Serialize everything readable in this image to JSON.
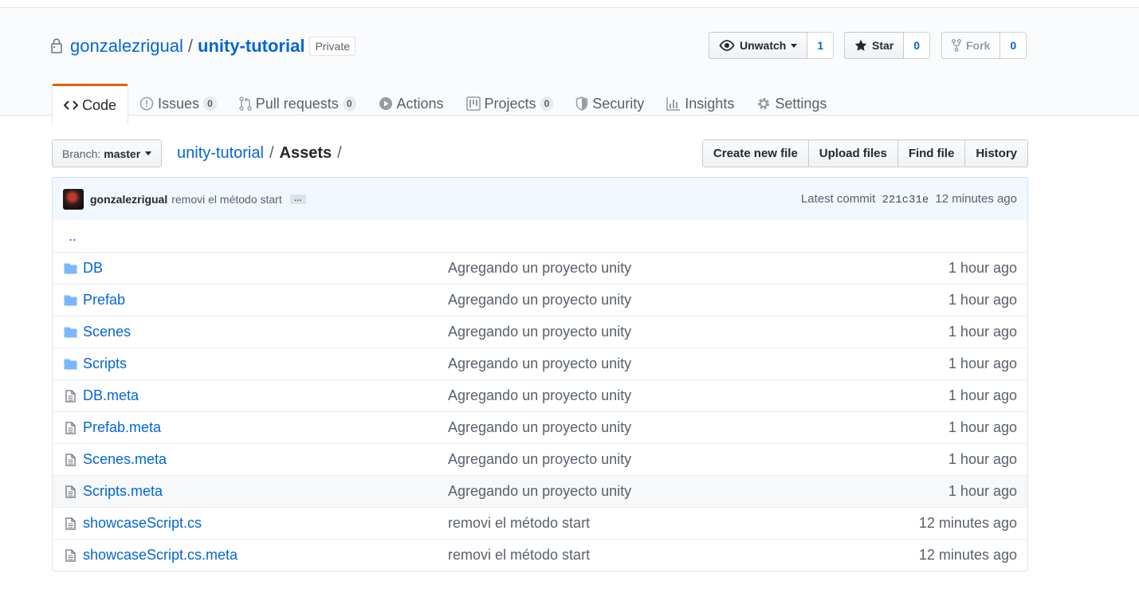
{
  "repo": {
    "owner": "gonzalezrigual",
    "separator": "/",
    "name": "unity-tutorial",
    "visibility": "Private"
  },
  "actions": {
    "watch": {
      "label": "Unwatch",
      "count": "1"
    },
    "star": {
      "label": "Star",
      "count": "0"
    },
    "fork": {
      "label": "Fork",
      "count": "0"
    }
  },
  "nav": {
    "code": {
      "label": "Code"
    },
    "issues": {
      "label": "Issues",
      "count": "0"
    },
    "pulls": {
      "label": "Pull requests",
      "count": "0"
    },
    "actions": {
      "label": "Actions"
    },
    "projects": {
      "label": "Projects",
      "count": "0"
    },
    "security": {
      "label": "Security"
    },
    "insights": {
      "label": "Insights"
    },
    "settings": {
      "label": "Settings"
    }
  },
  "file_nav": {
    "branch_label": "Branch:",
    "branch_value": "master",
    "breadcrumb_root": "unity-tutorial",
    "breadcrumb_sep": "/",
    "breadcrumb_current": "Assets",
    "breadcrumb_trail": "/",
    "create_new_file": "Create new file",
    "upload_files": "Upload files",
    "find_file": "Find file",
    "history": "History"
  },
  "commit": {
    "author": "gonzalezrigual",
    "message": "removi el método start",
    "ellipsis": "…",
    "latest_label": "Latest commit",
    "sha": "221c31e",
    "age": "12 minutes ago"
  },
  "files": {
    "up": "..",
    "items": [
      {
        "type": "dir",
        "name": "DB",
        "message": "Agregando un proyecto unity",
        "age": "1 hour ago"
      },
      {
        "type": "dir",
        "name": "Prefab",
        "message": "Agregando un proyecto unity",
        "age": "1 hour ago"
      },
      {
        "type": "dir",
        "name": "Scenes",
        "message": "Agregando un proyecto unity",
        "age": "1 hour ago"
      },
      {
        "type": "dir",
        "name": "Scripts",
        "message": "Agregando un proyecto unity",
        "age": "1 hour ago"
      },
      {
        "type": "file",
        "name": "DB.meta",
        "message": "Agregando un proyecto unity",
        "age": "1 hour ago"
      },
      {
        "type": "file",
        "name": "Prefab.meta",
        "message": "Agregando un proyecto unity",
        "age": "1 hour ago"
      },
      {
        "type": "file",
        "name": "Scenes.meta",
        "message": "Agregando un proyecto unity",
        "age": "1 hour ago"
      },
      {
        "type": "file",
        "name": "Scripts.meta",
        "message": "Agregando un proyecto unity",
        "age": "1 hour ago"
      },
      {
        "type": "file",
        "name": "showcaseScript.cs",
        "message": "removi el método start",
        "age": "12 minutes ago"
      },
      {
        "type": "file",
        "name": "showcaseScript.cs.meta",
        "message": "removi el método start",
        "age": "12 minutes ago"
      }
    ]
  },
  "icons": {
    "lock": "lock-icon",
    "eye": "eye-icon",
    "star": "star-icon",
    "fork": "repo-forked-icon",
    "code": "code-icon",
    "issue": "issue-opened-icon",
    "pull": "git-pull-request-icon",
    "play": "play-icon",
    "project": "project-icon",
    "shield": "shield-icon",
    "graph": "graph-icon",
    "gear": "gear-icon",
    "folder": "file-directory-icon",
    "file": "file-icon"
  },
  "colors": {
    "link": "#0366d6",
    "muted": "#586069",
    "nav_accent": "#e36209",
    "commit_bg": "#f1f8ff",
    "folder": "#79b8ff"
  }
}
